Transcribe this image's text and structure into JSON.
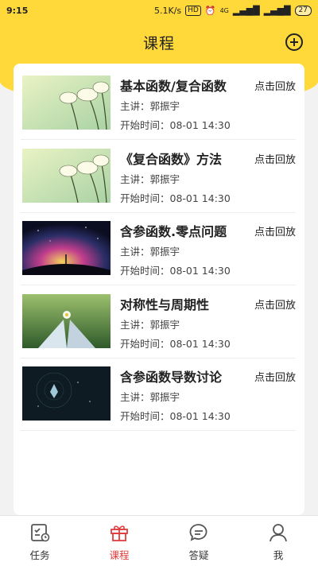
{
  "status_bar": {
    "time": "9:15",
    "net_speed": "5.1K/s",
    "hd_label": "HD",
    "network": "4G",
    "battery": "27"
  },
  "header": {
    "title": "课程",
    "add_icon": "plus-circle-icon"
  },
  "courses": [
    {
      "title": "基本函数/复合函数",
      "lecturer": "主讲：郭振宇",
      "start_time": "开始时间：08-01 14:30",
      "action": "点击回放",
      "thumb": "flowers"
    },
    {
      "title": "《复合函数》方法",
      "lecturer": "主讲：郭振宇",
      "start_time": "开始时间：08-01 14:30",
      "action": "点击回放",
      "thumb": "flowers"
    },
    {
      "title": "含参函数.零点问题",
      "lecturer": "主讲：郭振宇",
      "start_time": "开始时间：08-01 14:30",
      "action": "点击回放",
      "thumb": "galaxy"
    },
    {
      "title": "对称性与周期性",
      "lecturer": "主讲：郭振宇",
      "start_time": "开始时间：08-01 14:30",
      "action": "点击回放",
      "thumb": "book"
    },
    {
      "title": "含参函数导数讨论",
      "lecturer": "主讲：郭振宇",
      "start_time": "开始时间：08-01 14:30",
      "action": "点击回放",
      "thumb": "crystal"
    }
  ],
  "tabs": [
    {
      "label": "任务",
      "icon": "task-icon",
      "active": false
    },
    {
      "label": "课程",
      "icon": "gift-icon",
      "active": true
    },
    {
      "label": "答疑",
      "icon": "chat-icon",
      "active": false
    },
    {
      "label": "我",
      "icon": "person-icon",
      "active": false
    }
  ],
  "colors": {
    "brand_yellow": "#ffd83a",
    "active_red": "#e23c3c"
  }
}
